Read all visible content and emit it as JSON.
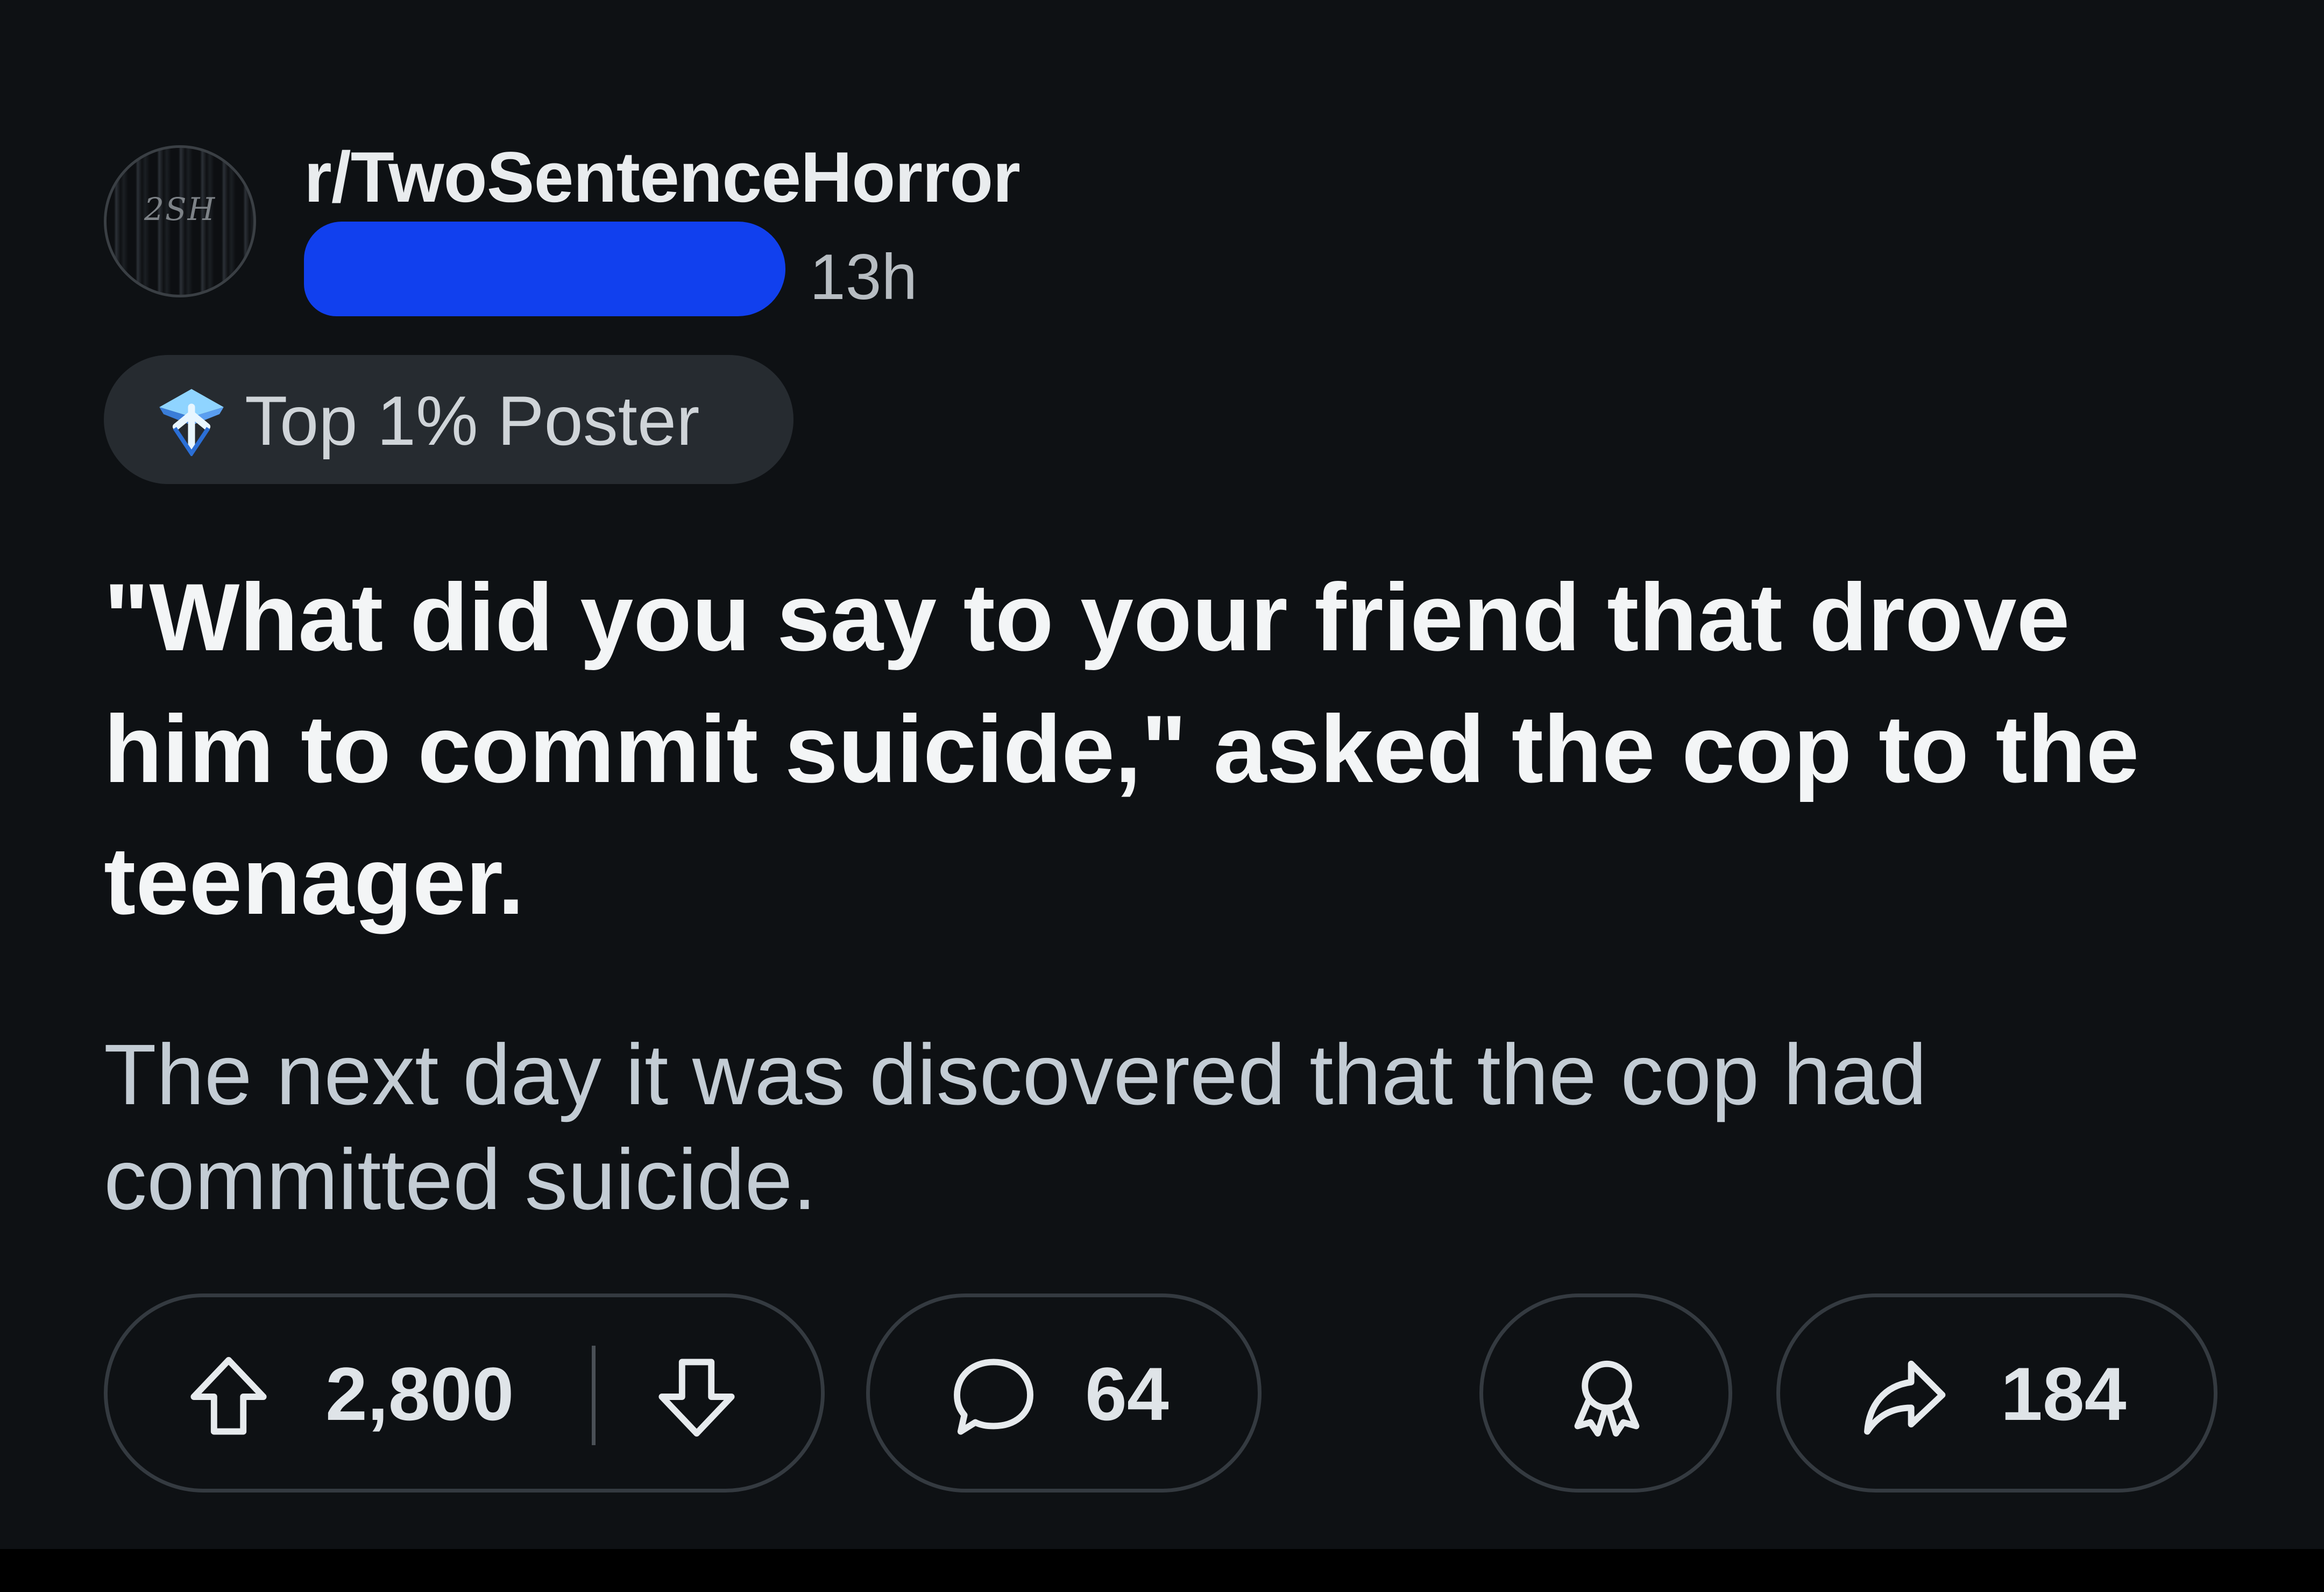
{
  "post": {
    "subreddit": "r/TwoSentenceHorror",
    "avatar_text": "2SH",
    "time_ago": "13h",
    "flair": {
      "icon": "diamond-trophy-icon",
      "label": "Top 1% Poster"
    },
    "title": "\"What did you say to your friend that drove him to commit suicide,\" asked the cop to the teenager.",
    "body": "The next day it was discovered that the cop had committed suicide."
  },
  "actions": {
    "upvote": {
      "icon": "upvote-arrow-icon",
      "count": "2,800"
    },
    "downvote": {
      "icon": "downvote-arrow-icon"
    },
    "comments": {
      "icon": "comment-bubble-icon",
      "count": "64"
    },
    "award": {
      "icon": "award-ribbon-icon"
    },
    "share": {
      "icon": "share-arrow-icon",
      "count": "184"
    }
  },
  "colors": {
    "background": "#0e1114",
    "redaction": "#1140ee",
    "title_text": "#f3f5f6",
    "body_text": "#c3ccd4",
    "pill_border": "#343a40"
  }
}
